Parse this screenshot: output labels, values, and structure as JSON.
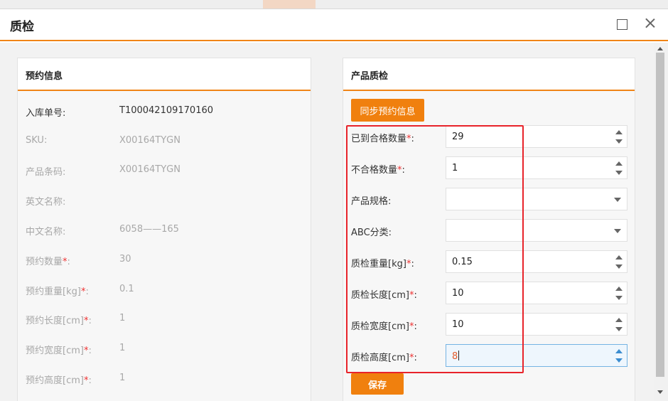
{
  "dialog": {
    "title": "质检"
  },
  "left_panel": {
    "title": "预约信息",
    "rows": [
      {
        "label": "入库单号:",
        "required": false,
        "value": "T100042109170160"
      },
      {
        "label": "SKU:",
        "required": false,
        "value": "X00164TYGN"
      },
      {
        "label": "产品条码:",
        "required": false,
        "value": "X00164TYGN"
      },
      {
        "label": "英文名称:",
        "required": false,
        "value": ""
      },
      {
        "label": "中文名称:",
        "required": false,
        "value": "6058——165"
      },
      {
        "label": "预约数量",
        "required": true,
        "value": "30"
      },
      {
        "label": "预约重量[kg]",
        "required": true,
        "value": "0.1"
      },
      {
        "label": "预约长度[cm]",
        "required": true,
        "value": "1"
      },
      {
        "label": "预约宽度[cm]",
        "required": true,
        "value": "1"
      },
      {
        "label": "预约高度[cm]",
        "required": true,
        "value": "1"
      }
    ]
  },
  "right_panel": {
    "title": "产品质检",
    "sync_label": "同步预约信息",
    "save_label": "保存",
    "fields": [
      {
        "label": "已到合格数量",
        "required": true,
        "value": "29",
        "kind": "number"
      },
      {
        "label": "不合格数量",
        "required": true,
        "value": "1",
        "kind": "number"
      },
      {
        "label": "产品规格:",
        "required": false,
        "value": "",
        "kind": "select"
      },
      {
        "label": "ABC分类:",
        "required": false,
        "value": "",
        "kind": "select"
      },
      {
        "label": "质检重量[kg]",
        "required": true,
        "value": "0.15",
        "kind": "number"
      },
      {
        "label": "质检长度[cm]",
        "required": true,
        "value": "10",
        "kind": "number"
      },
      {
        "label": "质检宽度[cm]",
        "required": true,
        "value": "10",
        "kind": "number"
      },
      {
        "label": "质检高度[cm]",
        "required": true,
        "value": "8",
        "kind": "number"
      }
    ]
  },
  "colors": {
    "accent": "#f0800e",
    "highlight": "#e8232a",
    "required": "#ee3333"
  },
  "icons": {
    "maximize": "maximize-icon",
    "close": "close-icon"
  }
}
